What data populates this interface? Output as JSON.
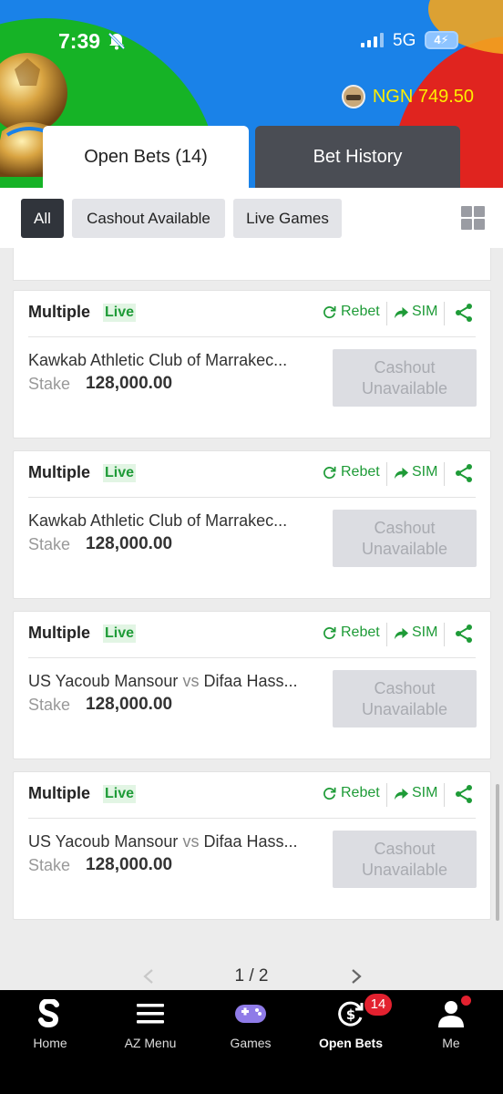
{
  "status_bar": {
    "time": "7:39",
    "network": "5G",
    "battery": "4"
  },
  "balance": {
    "text": "NGN 749.50"
  },
  "tabs": [
    {
      "label": "Open Bets (14)",
      "active": true
    },
    {
      "label": "Bet History",
      "active": false
    }
  ],
  "filters": [
    {
      "label": "All",
      "active": true
    },
    {
      "label": "Cashout Available",
      "active": false
    },
    {
      "label": "Live Games",
      "active": false
    }
  ],
  "bets": [
    {
      "type": "Multiple",
      "badge": "Live",
      "rebet": "Rebet",
      "sim": "SIM",
      "home": "Kawkab Athletic Club of Marrakec...",
      "vs": "",
      "away": "",
      "stake_label": "Stake",
      "stake": "128,000.00",
      "cashout": "Cashout Unavailable"
    },
    {
      "type": "Multiple",
      "badge": "Live",
      "rebet": "Rebet",
      "sim": "SIM",
      "home": "Kawkab Athletic Club of Marrakec...",
      "vs": "",
      "away": "",
      "stake_label": "Stake",
      "stake": "128,000.00",
      "cashout": "Cashout Unavailable"
    },
    {
      "type": "Multiple",
      "badge": "Live",
      "rebet": "Rebet",
      "sim": "SIM",
      "home": "US Yacoub Mansour",
      "vs": "vs",
      "away": "Difaa Hass...",
      "stake_label": "Stake",
      "stake": "128,000.00",
      "cashout": "Cashout Unavailable"
    },
    {
      "type": "Multiple",
      "badge": "Live",
      "rebet": "Rebet",
      "sim": "SIM",
      "home": "US Yacoub Mansour",
      "vs": "vs",
      "away": "Difaa Hass...",
      "stake_label": "Stake",
      "stake": "128,000.00",
      "cashout": "Cashout Unavailable"
    }
  ],
  "pagination": {
    "text": "1 / 2"
  },
  "bottom_nav": [
    {
      "label": "Home",
      "icon": "sporty-logo-icon"
    },
    {
      "label": "AZ Menu",
      "icon": "menu-icon"
    },
    {
      "label": "Games",
      "icon": "gamepad-icon"
    },
    {
      "label": "Open Bets",
      "icon": "open-bets-icon",
      "badge": "14",
      "active": true
    },
    {
      "label": "Me",
      "icon": "user-icon"
    }
  ],
  "colors": {
    "accent_green": "#1e9b37",
    "balance_yellow": "#ffee00",
    "badge_red": "#e3212f"
  }
}
